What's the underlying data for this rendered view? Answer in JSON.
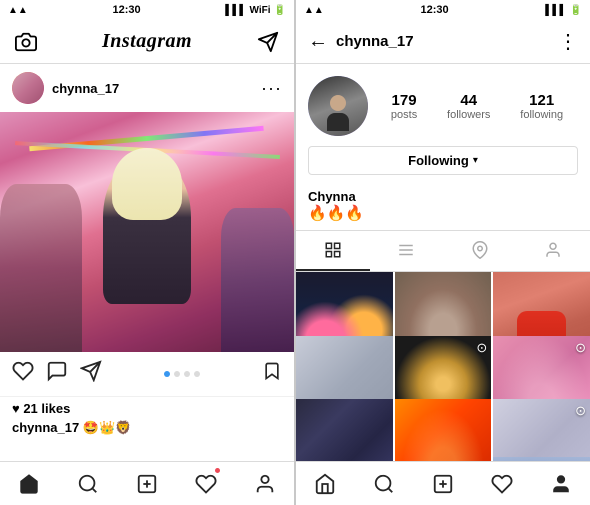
{
  "left_phone": {
    "status_bar": {
      "time": "12:30"
    },
    "top_nav": {
      "logo": "Instagram",
      "camera_icon": "📷",
      "send_icon": "✉"
    },
    "post": {
      "username": "chynna_17",
      "likes_count": "♥ 21 likes",
      "caption_user": "chynna_17",
      "caption_emojis": "🤩👑🦁",
      "dots": [
        "active",
        "inactive",
        "inactive",
        "inactive"
      ]
    },
    "bottom_nav": {
      "home": "🏠",
      "search": "🔍",
      "add": "➕",
      "heart": "♡",
      "profile": "👤"
    }
  },
  "right_phone": {
    "status_bar": {
      "time": "12:30"
    },
    "top_nav": {
      "back": "←",
      "username": "chynna_17",
      "more": "⋮"
    },
    "profile": {
      "stats": {
        "posts": {
          "number": "179",
          "label": "posts"
        },
        "followers": {
          "number": "44",
          "label": "followers"
        },
        "following": {
          "number": "121",
          "label": "following"
        }
      },
      "following_btn": "Following",
      "name": "Chynna",
      "emojis": "🔥🔥🔥"
    },
    "tabs": [
      {
        "icon": "⊞",
        "active": true
      },
      {
        "icon": "☰",
        "active": false
      },
      {
        "icon": "📍",
        "active": false
      },
      {
        "icon": "👤",
        "active": false
      }
    ],
    "grid": [
      {
        "id": 1,
        "has_video": false
      },
      {
        "id": 2,
        "has_video": false
      },
      {
        "id": 3,
        "has_video": false
      },
      {
        "id": 4,
        "has_video": false
      },
      {
        "id": 5,
        "has_video": false
      },
      {
        "id": 6,
        "has_video": false
      },
      {
        "id": 7,
        "has_video": false
      },
      {
        "id": 8,
        "has_video": true
      },
      {
        "id": 9,
        "has_video": true
      }
    ],
    "bottom_nav": {
      "home": "🏠",
      "search": "🔍",
      "add": "➕",
      "heart": "♡",
      "profile": "👤"
    }
  }
}
